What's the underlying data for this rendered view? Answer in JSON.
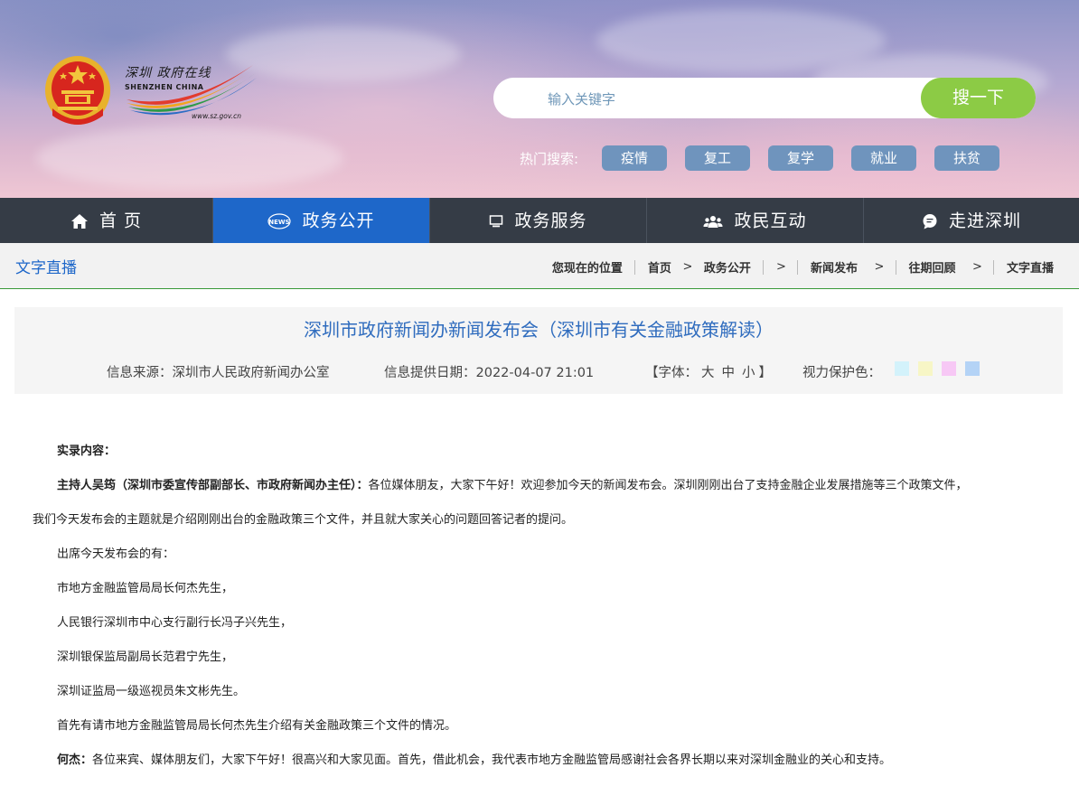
{
  "header": {
    "logo_cn": "深圳 政府在线",
    "logo_en": "SHENZHEN CHINA",
    "logo_url": "www.sz.gov.cn",
    "search_placeholder": "输入关键字",
    "search_button": "搜一下",
    "hot_label": "热门搜索:",
    "hot_tags": [
      "疫情",
      "复工",
      "复学",
      "就业",
      "扶贫"
    ]
  },
  "nav": [
    {
      "label": "首 页",
      "icon": "home-icon"
    },
    {
      "label": "政务公开",
      "icon": "news-icon",
      "active": true
    },
    {
      "label": "政务服务",
      "icon": "monitor-icon"
    },
    {
      "label": "政民互动",
      "icon": "users-icon"
    },
    {
      "label": "走进深圳",
      "icon": "chat-icon"
    }
  ],
  "crumbbar": {
    "section_title": "文字直播",
    "position_label": "您现在的位置",
    "items": [
      "首页",
      "政务公开",
      "新闻发布",
      "往期回顾",
      "文字直播"
    ]
  },
  "article": {
    "title": "深圳市政府新闻办新闻发布会（深圳市有关金融政策解读）",
    "source": "信息来源：深圳市人民政府新闻办公室",
    "date": "信息提供日期：2022-04-07 21:01",
    "font_open": "【字体：",
    "font_sizes": [
      "大",
      "中",
      "小"
    ],
    "font_close": "】",
    "eye_label": "视力保护色：",
    "eye_colors": [
      "#d3f2fb",
      "#f7f6c6",
      "#f7c8f5",
      "#b4d3f6"
    ]
  },
  "content": {
    "heading": "实录内容：",
    "host_name": "主持人吴筠（深圳市委宣传部副部长、市政府新闻办主任）：",
    "host_line1": "各位媒体朋友，大家下午好！欢迎参加今天的新闻发布会。深圳刚刚出台了支持金融企业发展措施等三个政策文件，",
    "host_line2": "我们今天发布会的主题就是介绍刚刚出台的金融政策三个文件，并且就大家关心的问题回答记者的提问。",
    "attend": "出席今天发布会的有：",
    "person1": "市地方金融监管局局长何杰先生，",
    "person2": "人民银行深圳市中心支行副行长冯子兴先生，",
    "person3": "深圳银保监局副局长范君宁先生，",
    "person4": "深圳证监局一级巡视员朱文彬先生。",
    "intro": "首先有请市地方金融监管局局长何杰先生介绍有关金融政策三个文件的情况。",
    "hejie_name": "何杰：",
    "hejie_line": "各位来宾、媒体朋友们，大家下午好！很高兴和大家见面。首先，借此机会，我代表市地方金融监管局感谢社会各界长期以来对深圳金融业的关心和支持。"
  }
}
